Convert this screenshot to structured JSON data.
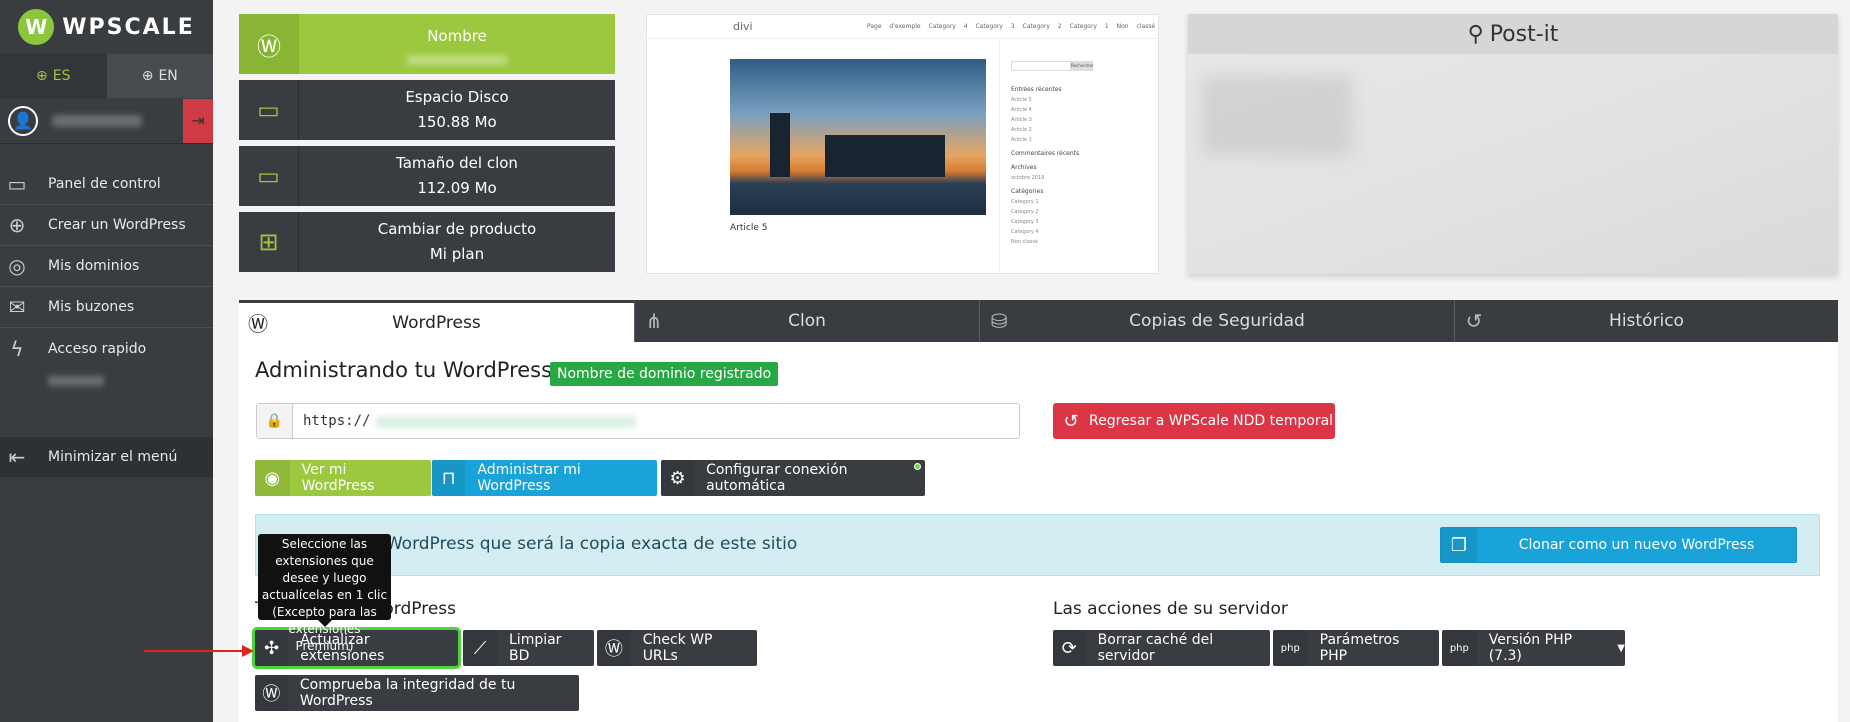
{
  "sidebar": {
    "brand": "WPSCALE",
    "lang": [
      {
        "label": "ES",
        "active": true
      },
      {
        "label": "EN",
        "active": false
      }
    ],
    "items": [
      {
        "label": "Panel de control",
        "icon": "monitor-icon"
      },
      {
        "label": "Crear un WordPress",
        "icon": "plus-circle-icon"
      },
      {
        "label": "Mis dominios",
        "icon": "globe-icon"
      },
      {
        "label": "Mis buzones",
        "icon": "mail-icon"
      },
      {
        "label": "Acceso rapido",
        "icon": "lightning-icon"
      }
    ],
    "minimize": "Minimizar el menú"
  },
  "cards": [
    {
      "title": "Nombre",
      "value": ""
    },
    {
      "title": "Espacio Disco",
      "value": "150.88 Mo"
    },
    {
      "title": "Tamaño del clon",
      "value": "112.09 Mo"
    },
    {
      "title": "Cambiar de producto",
      "value": "Mi plan"
    }
  ],
  "preview": {
    "brand": "divi",
    "menu": "Page d'exemple Category 4 Category 3 Category 2 Category 1 Non classé",
    "post_title": "Article 5",
    "search_button": "Rechercher",
    "sidebar_sections": [
      {
        "heading": "Entrées récentes",
        "items": [
          "Article 5",
          "Article 4",
          "Article 3",
          "Article 2",
          "Article 1"
        ]
      },
      {
        "heading": "Commentaires récents",
        "items": []
      },
      {
        "heading": "Archives",
        "items": [
          "octobre 2019"
        ]
      },
      {
        "heading": "Catégories",
        "items": [
          "Category 1",
          "Category 2",
          "Category 3",
          "Category 4",
          "Non classé"
        ]
      }
    ]
  },
  "postit": {
    "title": "Post-it"
  },
  "tabs": [
    {
      "label": "WordPress",
      "active": true
    },
    {
      "label": "Clon",
      "active": false
    },
    {
      "label": "Copias de Seguridad",
      "active": false
    },
    {
      "label": "Histórico",
      "active": false
    }
  ],
  "main": {
    "title": "Administrando tu WordPress",
    "badge": "Nombre de dominio registrado",
    "url_prefix": "https://",
    "revert_button": "Regresar a WPScale NDD temporal",
    "actions": {
      "view": "Ver mi WordPress",
      "admin": "Administrar mi WordPress",
      "autologin": "Configurar conexión automática"
    },
    "clone_text": "vo WordPress que será la copia exacta de este sitio",
    "clone_button": "Clonar como un nuevo WordPress",
    "section_left": "Tus acciones WordPress",
    "section_right": "Las acciones de su servidor",
    "wp_actions": {
      "update_plugins": "Actualizar extensiones",
      "clean_db": "Limpiar BD",
      "check_urls": "Check WP URLs",
      "integrity": "Comprueba la integridad de tu WordPress"
    },
    "server_actions": {
      "clear_cache": "Borrar caché del servidor",
      "php_params": "Parámetros PHP",
      "php_version": "Versión PHP (7.3)"
    },
    "tooltip": "Seleccione las extensiones que desee y luego actualícelas en 1 clic (Excepto para las extensiones Premium)"
  }
}
